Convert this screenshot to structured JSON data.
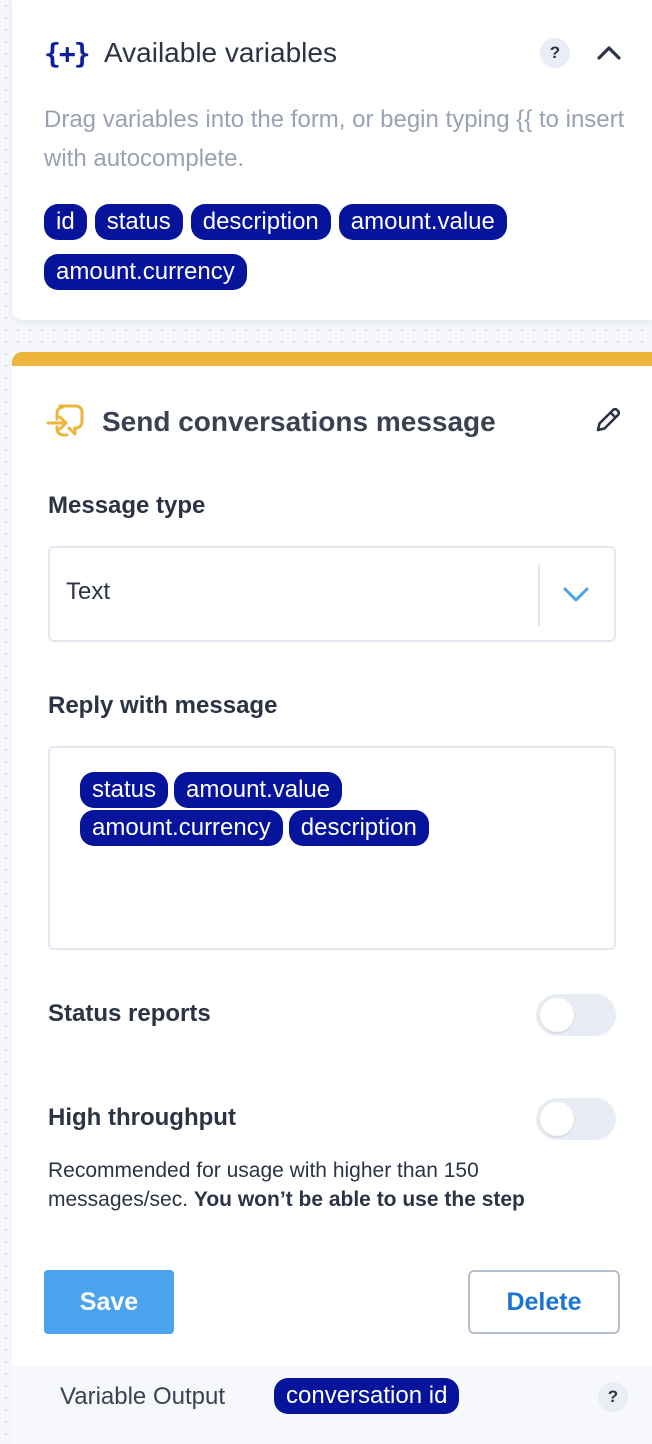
{
  "variables_panel": {
    "title": "Available variables",
    "help": "?",
    "description": "Drag variables into the form, or begin typing {{ to insert with autocomplete.",
    "chips": [
      "id",
      "status",
      "description",
      "amount.value",
      "amount.currency"
    ]
  },
  "step": {
    "accent_color": "#ecb53b",
    "title": "Send conversations message",
    "message_type_label": "Message type",
    "message_type_value": "Text",
    "reply_label": "Reply with message",
    "reply_chips": [
      "status",
      "amount.value",
      "amount.currency",
      "description"
    ],
    "status_reports_label": "Status reports",
    "status_reports_on": false,
    "high_throughput_label": "High throughput",
    "high_throughput_on": false,
    "note_plain": "Recommended for usage with higher than 150 messages/sec. ",
    "note_bold": "You won’t be able to use the step"
  },
  "actions": {
    "save_label": "Save",
    "delete_label": "Delete"
  },
  "output": {
    "label": "Variable Output",
    "chip": "conversation id",
    "help": "?"
  },
  "colors": {
    "chip": "#06139b",
    "save": "#4ba3ee",
    "delete_text": "#1b73d4"
  }
}
